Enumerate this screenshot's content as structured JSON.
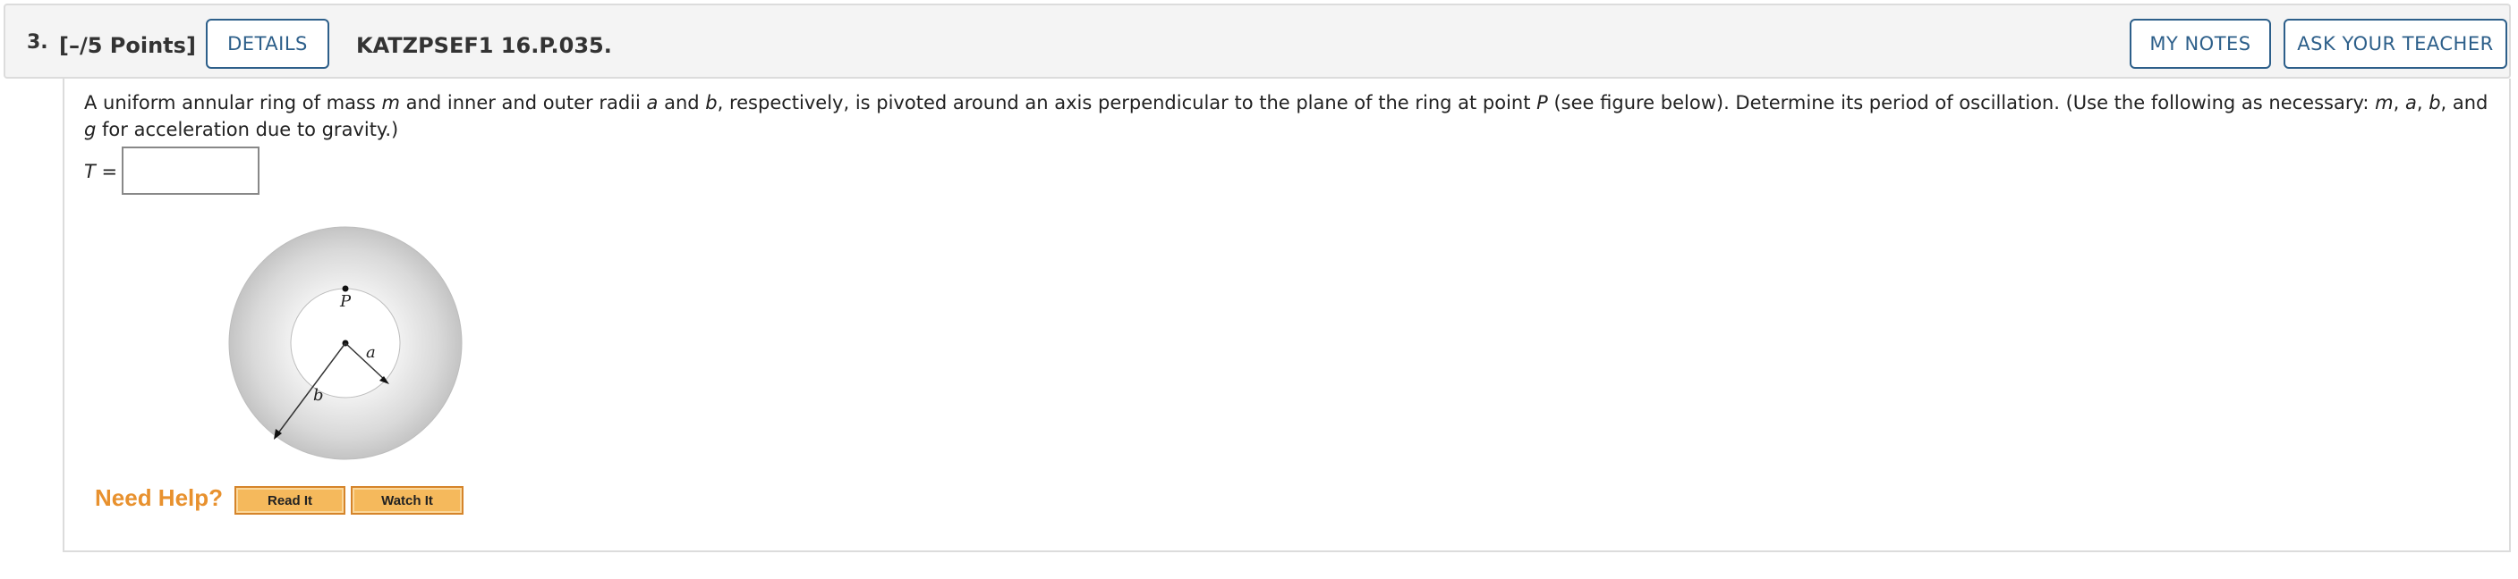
{
  "header": {
    "number": "3.",
    "points": "[–/5 Points]",
    "details_label": "DETAILS",
    "code": "KATZPSEF1 16.P.035.",
    "my_notes_label": "MY NOTES",
    "ask_teacher_label": "ASK YOUR TEACHER"
  },
  "problem": {
    "text_1": "A uniform annular ring of mass ",
    "var_m": "m",
    "text_2": " and inner and outer radii ",
    "var_a": "a",
    "text_3": " and ",
    "var_b": "b",
    "text_4": ", respectively, is pivoted around an axis perpendicular to the plane of the ring at point ",
    "var_P": "P",
    "text_5": " (see figure below). Determine its period of oscillation. (Use the following as necessary: ",
    "list_m": "m",
    "sep1": ", ",
    "list_a": "a",
    "sep2": ", ",
    "list_b": "b",
    "sep3": ", and ",
    "list_g": "g",
    "text_6": " for acceleration due to gravity.)"
  },
  "answer": {
    "var": "T",
    "eq": " =",
    "value": ""
  },
  "figure": {
    "label_P": "P",
    "label_a": "a",
    "label_b": "b"
  },
  "help": {
    "need_help": "Need Help?",
    "read_it": "Read It",
    "watch_it": "Watch It"
  },
  "colors": {
    "accent": "#2d5f8a",
    "help_orange": "#e8912e",
    "help_button": "#f5b95c"
  }
}
